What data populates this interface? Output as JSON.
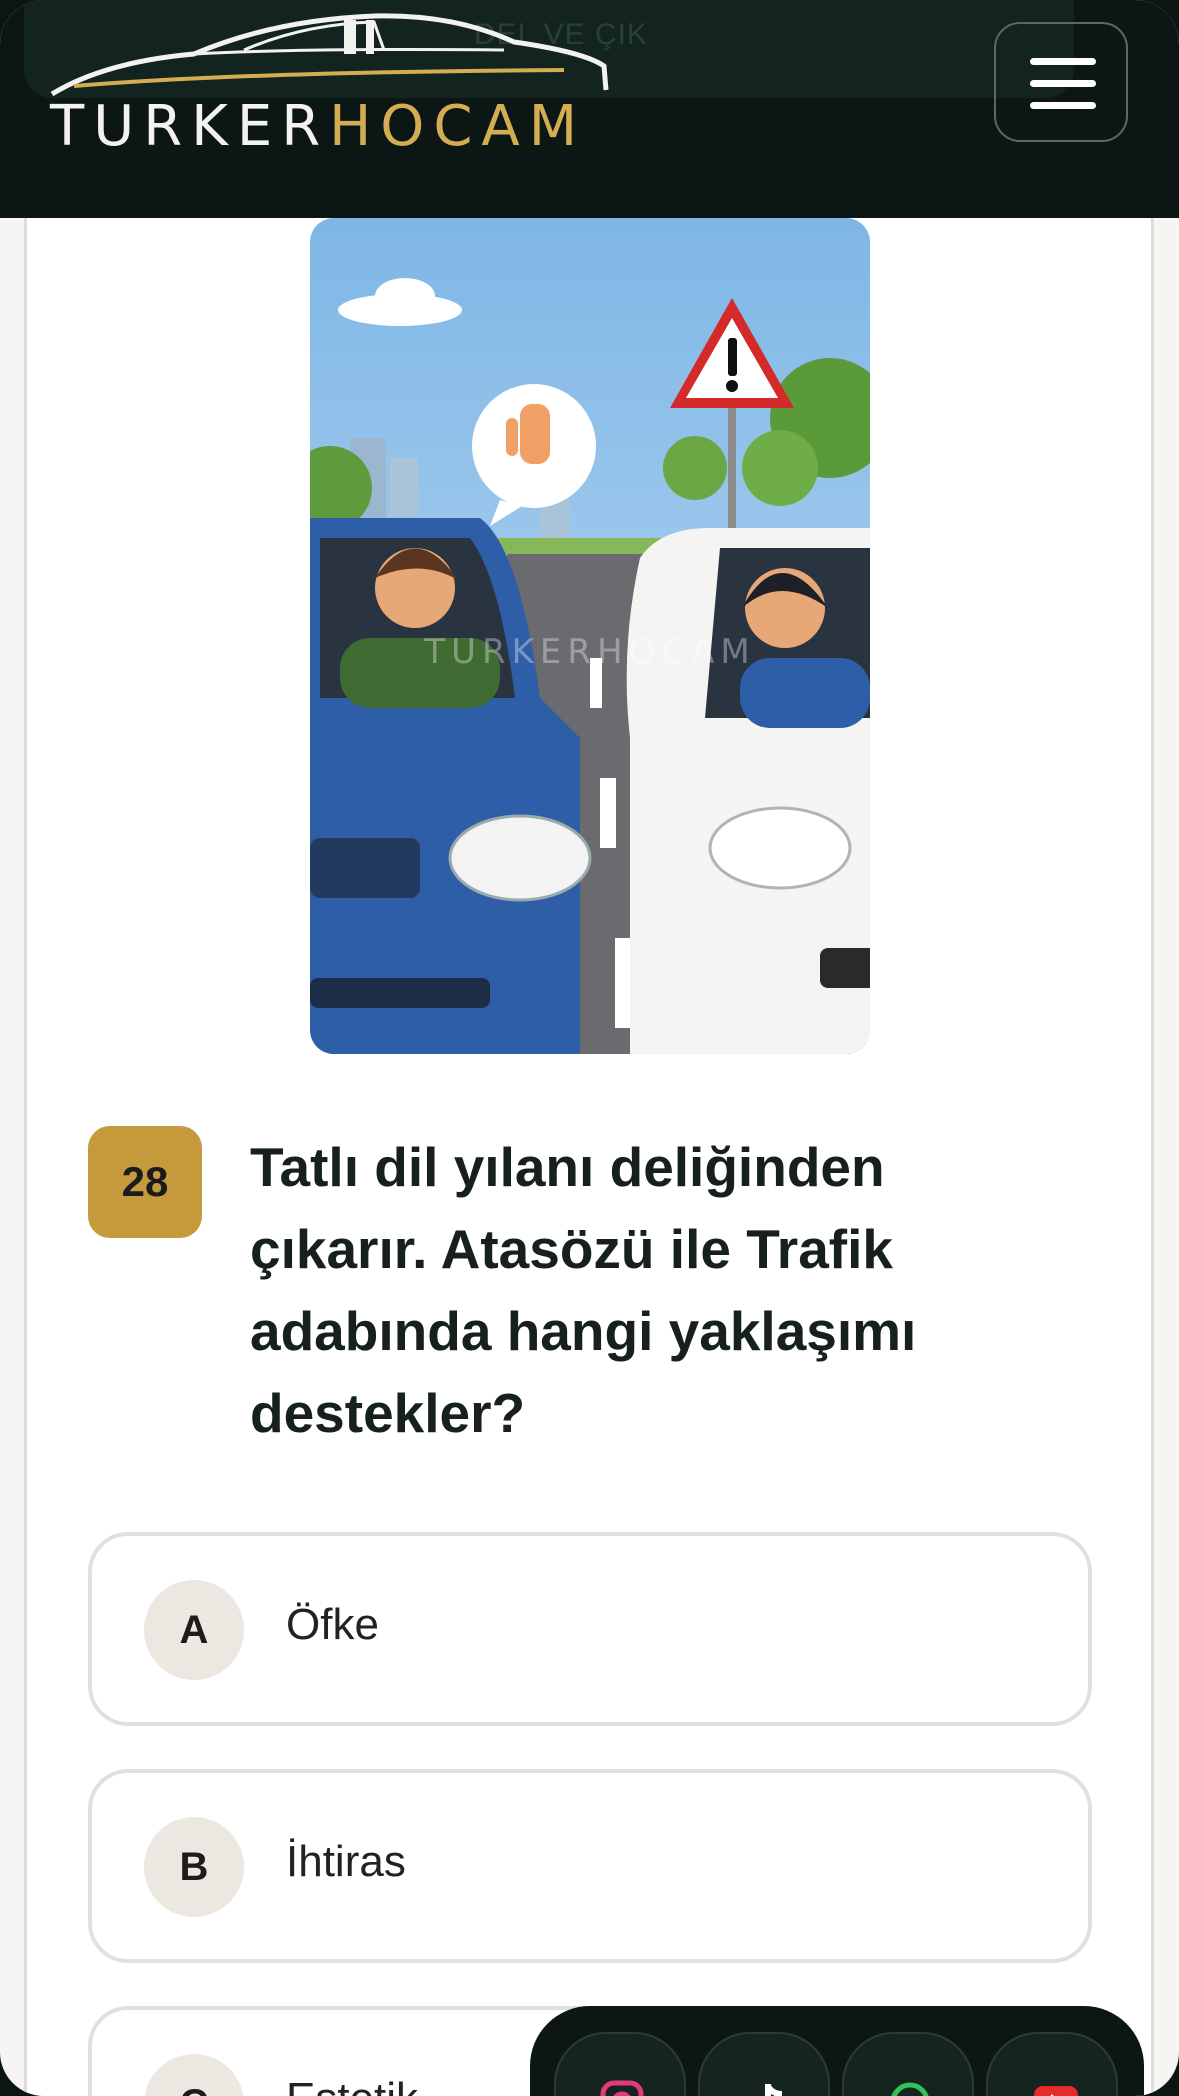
{
  "header": {
    "ghost_text": "DEL VE ÇIK",
    "logo_part1": "TURKER",
    "logo_part2": "HOCAM"
  },
  "illustration": {
    "watermark": "TURKERHOCAM",
    "description_icons": [
      "warning-sign-icon",
      "stop-hand-icon"
    ]
  },
  "question": {
    "number": "28",
    "text": "Tatlı dil yılanı deliğinden çıkarır. Atasözü ile Trafik adabında hangi yaklaşımı destekler?"
  },
  "options": [
    {
      "letter": "A",
      "text": "Öfke"
    },
    {
      "letter": "B",
      "text": "İhtiras"
    },
    {
      "letter": "C",
      "text": "Estetik"
    }
  ],
  "social": [
    "instagram-icon",
    "tiktok-icon",
    "whatsapp-icon",
    "youtube-icon"
  ],
  "colors": {
    "header_bg": "#0c1715",
    "accent_gold": "#c49a3c",
    "logo_gold": "#d4ac52"
  }
}
